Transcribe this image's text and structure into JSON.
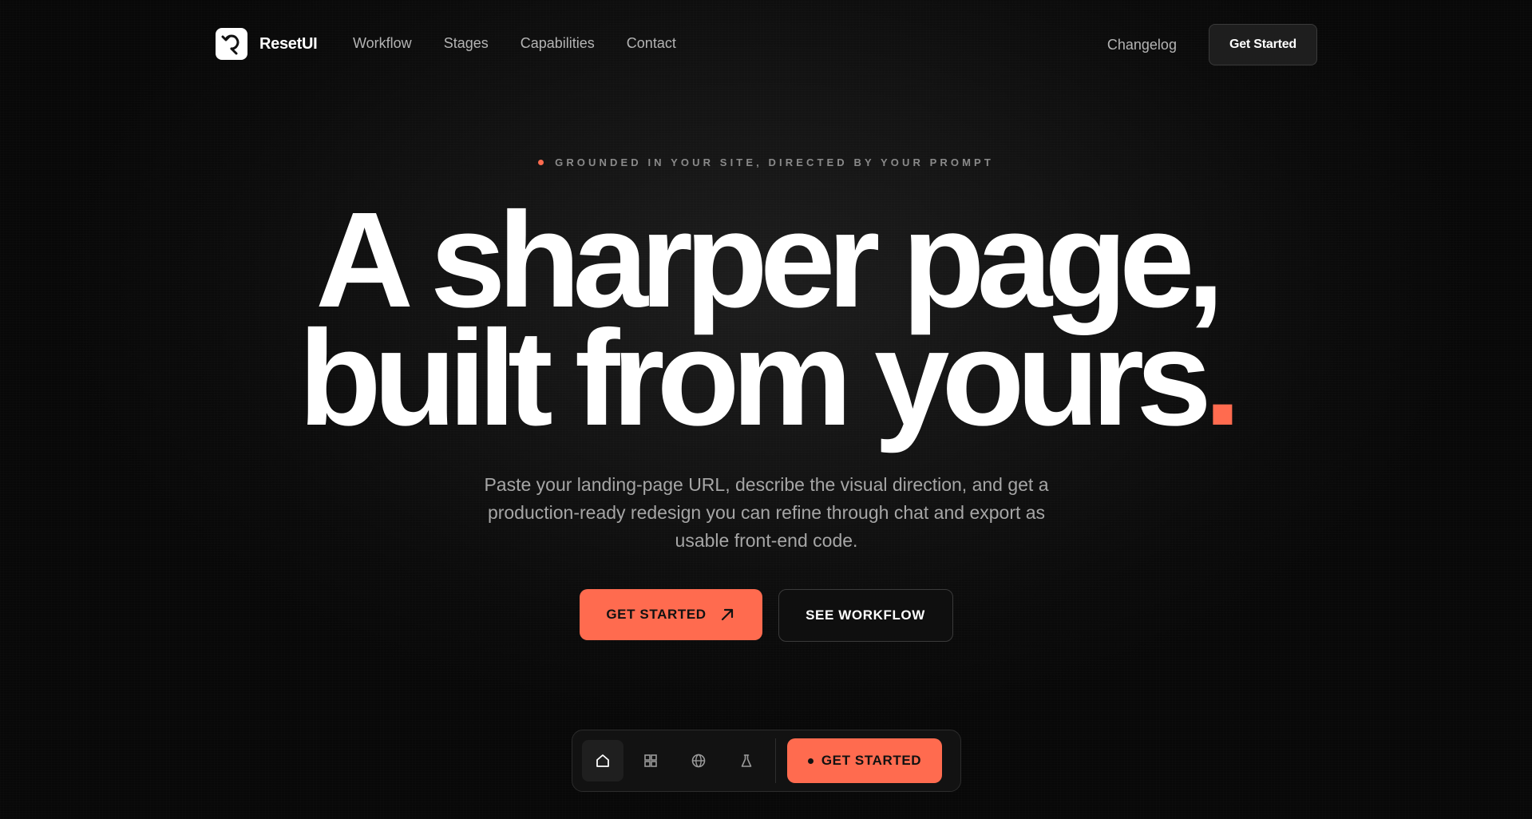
{
  "nav": {
    "logo_text": "ResetUI",
    "links": [
      "Workflow",
      "Stages",
      "Capabilities",
      "Contact"
    ],
    "changelog": "Changelog",
    "cta": "Get Started"
  },
  "hero": {
    "eyebrow": "GROUNDED IN YOUR SITE, DIRECTED BY YOUR PROMPT",
    "headline_line1": "A sharper page,",
    "headline_line2": "built from yours",
    "headline_dot": ".",
    "subhead": "Paste your landing-page URL, describe the visual direction, and get a production-ready redesign you can refine through chat and export as usable front-end code.",
    "primary_cta": "GET STARTED",
    "secondary_cta": "SEE WORKFLOW"
  },
  "dock": {
    "icons": [
      "home-icon",
      "grid-icon",
      "globe-icon",
      "flask-icon"
    ],
    "cta": "GET STARTED"
  },
  "colors": {
    "accent": "#ff6b4f",
    "background": "#0b0b0b",
    "text": "#ffffff",
    "muted": "#a6a6a6"
  }
}
